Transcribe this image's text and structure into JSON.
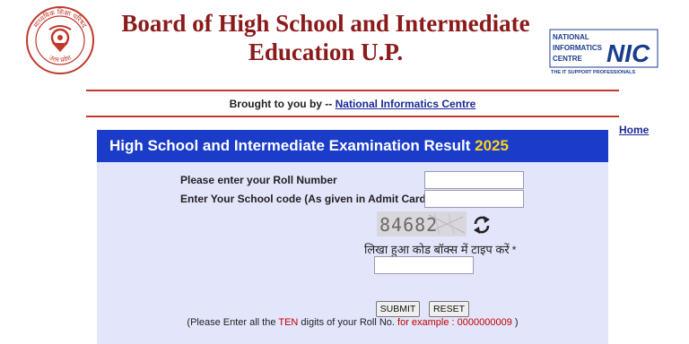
{
  "header": {
    "seal_text_top": "माध्यमिक शिक्षा परिषद",
    "seal_text_bottom": "उत्तर प्रदेश",
    "title_line1": "Board of High School and Intermediate",
    "title_line2": "Education U.P.",
    "nic_line1": "NATIONAL",
    "nic_line2": "INFORMATICS",
    "nic_line3": "CENTRE",
    "nic_mark": "NIC",
    "nic_tagline": "THE IT SUPPORT PROFESSIONALS"
  },
  "brought_by": {
    "prefix": "Brought to you by --",
    "link": "National Informatics Centre"
  },
  "nav": {
    "home": "Home"
  },
  "panel": {
    "title": "High School and Intermediate Examination Result",
    "year": "2025"
  },
  "form": {
    "roll_label": "Please enter your Roll Number",
    "roll_value": "",
    "school_label": "Enter Your School code (As given in Admit Card)",
    "school_value": "",
    "captcha_code": "84682",
    "captcha_label": "लिखा हुआ कोड बॉक्स में टाइप करें",
    "captcha_required": "*",
    "captcha_value": "",
    "submit_label": "SUBMIT",
    "reset_label": "RESET"
  },
  "note": {
    "p1": "(Please Enter all the",
    "ten": "TEN",
    "p2": "digits of your Roll No.",
    "example": "for example : 0000000009",
    "p3": ")"
  },
  "colors": {
    "title": "#8b1a1a",
    "panel_header": "#1a3cc9",
    "year": "#ffd21a",
    "panel_bg": "#e3e5fb",
    "link": "#1a2b99",
    "warning": "#c00000"
  }
}
